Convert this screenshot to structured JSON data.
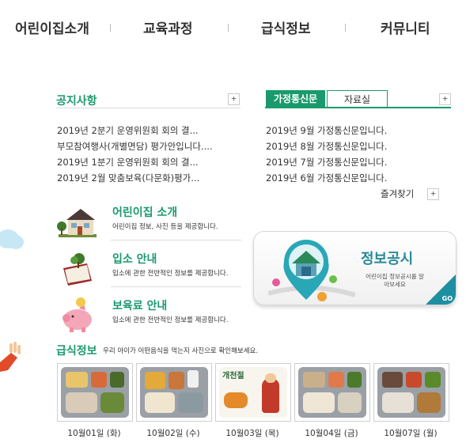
{
  "topnav": {
    "items": [
      "어린이집소개",
      "교육과정",
      "급식정보",
      "커뮤니티"
    ]
  },
  "notice": {
    "title": "공지사항",
    "more": "+",
    "items": [
      "2019년 2분기 운영위원회 회의 결...",
      "부모참여행사(개별면담) 평가안입니다....",
      "2019년 1분기 운영위원회 회의 결...",
      "2019년 2월 맞춤보육(다문화)평가..."
    ]
  },
  "letters": {
    "tabs": [
      "가정통신문",
      "자료실"
    ],
    "more": "+",
    "items": [
      "2019년 9월 가정통신문입니다.",
      "2019년 8월 가정통신문입니다.",
      "2019년 7월 가정통신문입니다.",
      "2019년 6월 가정통신문입니다."
    ],
    "favorites": "즐겨찾기",
    "favorites_more": "+"
  },
  "features": [
    {
      "icon": "house-icon",
      "title": "어린이집 소개",
      "desc": "어린이집 정보, 사진 등을 제공합니다."
    },
    {
      "icon": "book-plant-icon",
      "title": "입소 안내",
      "desc": "입소에 관한 전반적인 정보를 제공합니다."
    },
    {
      "icon": "piggy-bank-icon",
      "title": "보육료 안내",
      "desc": "입소에 관한 전반적인 정보를 제공합니다."
    }
  ],
  "info_banner": {
    "title": "정보공시",
    "subtitle": "어린이집 정보공시를 알아보세요",
    "go": "GO"
  },
  "meal": {
    "title": "급식정보",
    "desc": "우리 아이가 어떤음식을 먹는지 사진으로 확인해보세요.",
    "photos": [
      {
        "date": "10월01일 (화)"
      },
      {
        "date": "10월02일 (수)"
      },
      {
        "date": "10월03일 (목)",
        "poster_text": "개천절"
      },
      {
        "date": "10월04일 (금)"
      },
      {
        "date": "10월07일 (월)"
      }
    ]
  },
  "colors": {
    "accent": "#1a9a6c",
    "banner_accent": "#1d8fa0"
  }
}
